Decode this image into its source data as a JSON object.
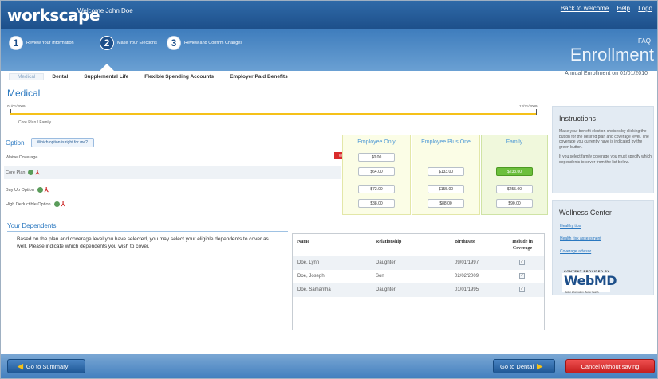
{
  "header": {
    "logo": "workscape",
    "welcome": "Welcome John Doe",
    "links": [
      "Back to welcome",
      "Help",
      "Logo"
    ]
  },
  "steps": [
    {
      "num": "1",
      "label": "Review Your Information"
    },
    {
      "num": "2",
      "label": "Make Your Elections"
    },
    {
      "num": "3",
      "label": "Review and Confirm Changes"
    }
  ],
  "faq": "FAQ",
  "enrollment_title": "Enrollment",
  "tabs": [
    "Medical",
    "Dental",
    "Supplemental Life",
    "Flexible Spending Accounts",
    "Employer Paid Benefits"
  ],
  "annual_enrollment": "Annual Enrollment on 01/01/2010",
  "page_title": "Medical",
  "timeline": {
    "start": "01/01/2009",
    "end": "12/31/2009",
    "label": "Core Plan / Family"
  },
  "option_label": "Option",
  "option_button": "Which option is right for me?",
  "plans": [
    "Waive Coverage",
    "Core Plan",
    "Buy Up Option",
    "High Deductible Option"
  ],
  "waive_tag": "Waive",
  "columns": [
    {
      "name": "Employee Only",
      "prices": [
        "$0.00",
        "$64.00",
        "$72.00",
        "$38.00"
      ]
    },
    {
      "name": "Employee Plus One",
      "prices": [
        "",
        "$133.00",
        "$155.00",
        "$88.00"
      ]
    },
    {
      "name": "Family",
      "prices": [
        "",
        "$233.00",
        "$255.00",
        "$90.00"
      ]
    }
  ],
  "dependents": {
    "title": "Your Dependents",
    "text": "Based on the plan and coverage level you have selected, you may select your eligible dependents to cover as well. Please indicate which dependents you wish to cover.",
    "headers": [
      "Name",
      "Relationship",
      "BirthDate",
      "Include in Coverage"
    ],
    "rows": [
      {
        "name": "Doe, Lynn",
        "relationship": "Daughter",
        "birth": "09/01/1997",
        "check": "✓"
      },
      {
        "name": "Doe, Joseph",
        "relationship": "Son",
        "birth": "02/02/2009",
        "check": "✓"
      },
      {
        "name": "Doe, Samantha",
        "relationship": "Daughter",
        "birth": "01/01/1995",
        "check": "✓"
      }
    ]
  },
  "instructions": {
    "title": "Instructions",
    "p1": "Make your benefit election choices by clicking the button for the desired plan and coverage level. The coverage you currently have is indicated by the green button.",
    "p2": "If you select family coverage you must specify which dependents to cover from the list below."
  },
  "wellness": {
    "title": "Wellness Center",
    "links": [
      "Healthy tips",
      "Health risk assessment",
      "Coverage advisor"
    ],
    "provided": "CONTENT PROVIDED BY",
    "brand": "WebMD",
    "tagline": "Better information. Better health."
  },
  "footer": {
    "summary": "Go to Summary",
    "dental": "Go to Dental",
    "cancel": "Cancel without saving"
  },
  "colors": {
    "accent": "#2a78c0",
    "header": "#1d4f8a",
    "selected": "#6cbf3c",
    "waive": "#d92b2b",
    "timeline": "#f5c119"
  }
}
